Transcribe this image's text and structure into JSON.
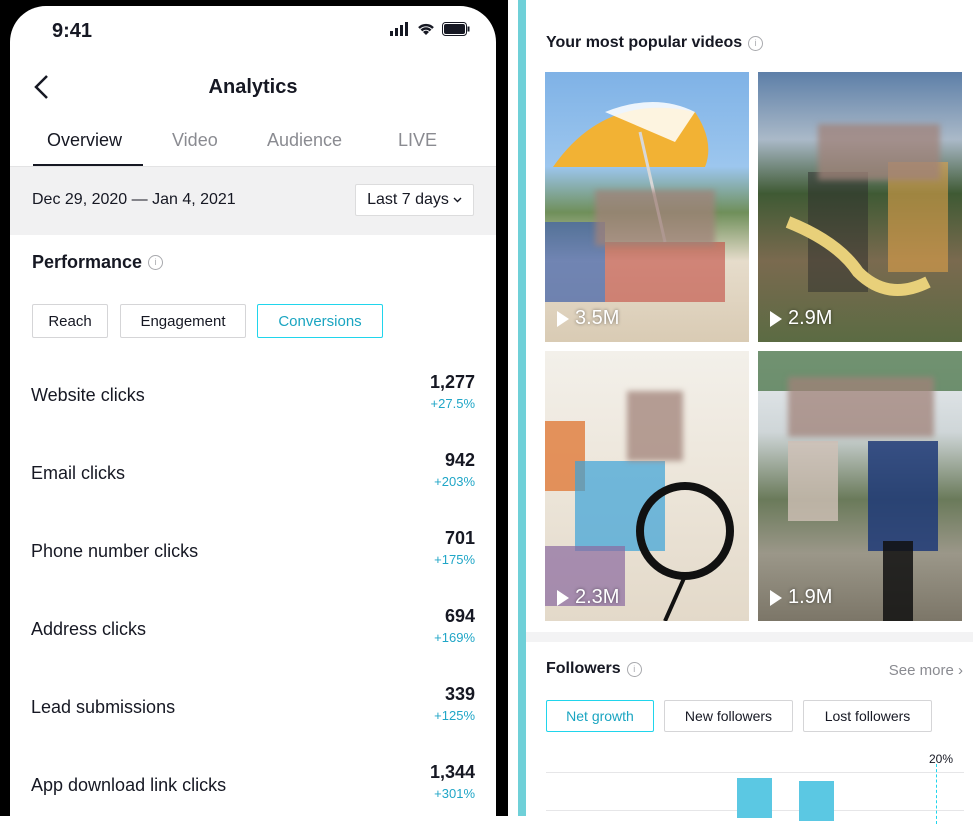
{
  "status": {
    "time": "9:41"
  },
  "header": {
    "title": "Analytics"
  },
  "tabs": [
    {
      "label": "Overview"
    },
    {
      "label": "Video"
    },
    {
      "label": "Audience"
    },
    {
      "label": "LIVE"
    }
  ],
  "date": {
    "range": "Dec 29, 2020 — Jan 4, 2021",
    "period": "Last 7 days"
  },
  "performance": {
    "title": "Performance",
    "chips": [
      {
        "label": "Reach"
      },
      {
        "label": "Engagement"
      },
      {
        "label": "Conversions"
      }
    ],
    "metrics": [
      {
        "label": "Website clicks",
        "value": "1,277",
        "change": "+27.5%"
      },
      {
        "label": "Email clicks",
        "value": "942",
        "change": "+203%"
      },
      {
        "label": "Phone number clicks",
        "value": "701",
        "change": "+175%"
      },
      {
        "label": "Address clicks",
        "value": "694",
        "change": "+169%"
      },
      {
        "label": "Lead submissions",
        "value": "339",
        "change": "+125%"
      },
      {
        "label": "App download link clicks",
        "value": "1,344",
        "change": "+301%"
      }
    ]
  },
  "popular": {
    "title": "Your most popular videos",
    "videos": [
      {
        "views": "3.5M"
      },
      {
        "views": "2.9M"
      },
      {
        "views": "2.3M"
      },
      {
        "views": "1.9M"
      }
    ]
  },
  "followers": {
    "title": "Followers",
    "see_more": "See more ›",
    "chips": [
      {
        "label": "Net growth"
      },
      {
        "label": "New followers"
      },
      {
        "label": "Lost followers"
      }
    ],
    "axis_label": "20%"
  },
  "colors": {
    "accent": "#20d5ec",
    "accent_text": "#1aa5c1",
    "change": "#20a6c7",
    "bar": "#5bc8e3"
  }
}
